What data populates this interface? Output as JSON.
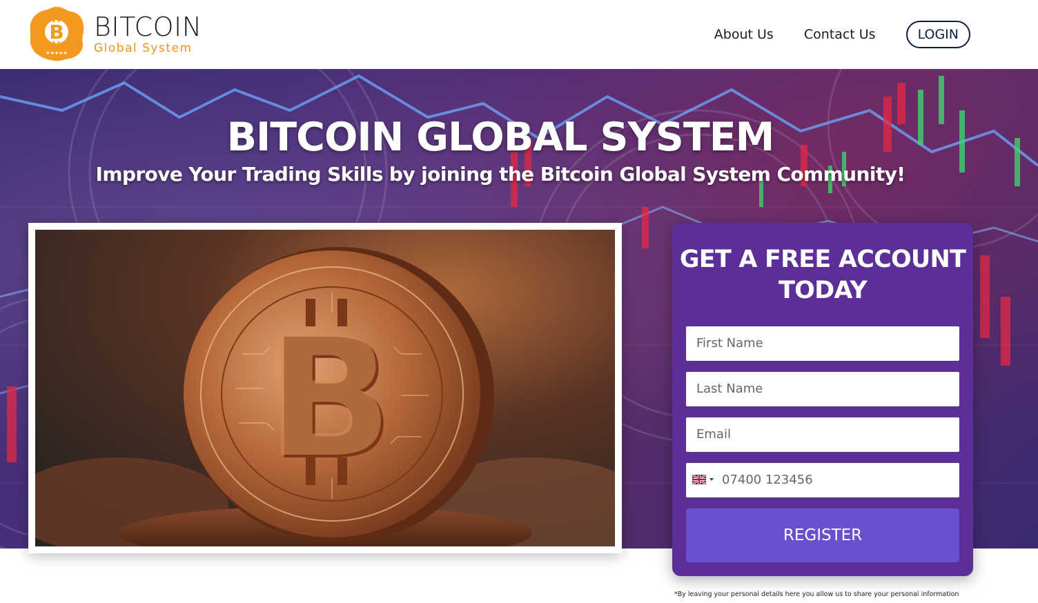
{
  "header": {
    "logo": {
      "main": "BITCOIN",
      "sub": "Global System",
      "icon": "bitcoin-logo-icon"
    },
    "nav": {
      "about": "About Us",
      "contact": "Contact Us",
      "login": "LOGIN"
    }
  },
  "hero": {
    "title": "BITCOIN GLOBAL SYSTEM",
    "subtitle": "Improve Your Trading Skills by joining the Bitcoin Global System Community!"
  },
  "form": {
    "title_line1": "GET A FREE ACCOUNT",
    "title_line2": "TODAY",
    "first_name_placeholder": "First Name",
    "last_name_placeholder": "Last Name",
    "email_placeholder": "Email",
    "phone_placeholder": "07400 123456",
    "phone_flag": "uk-flag-icon",
    "register_label": "REGISTER"
  },
  "disclaimer": "*By leaving your personal details here you allow us to share your personal information",
  "colors": {
    "accent_orange": "#f0921c",
    "navy": "#0c1d44",
    "form_purple": "#5c2f98",
    "button_purple": "#6a4fcf"
  }
}
